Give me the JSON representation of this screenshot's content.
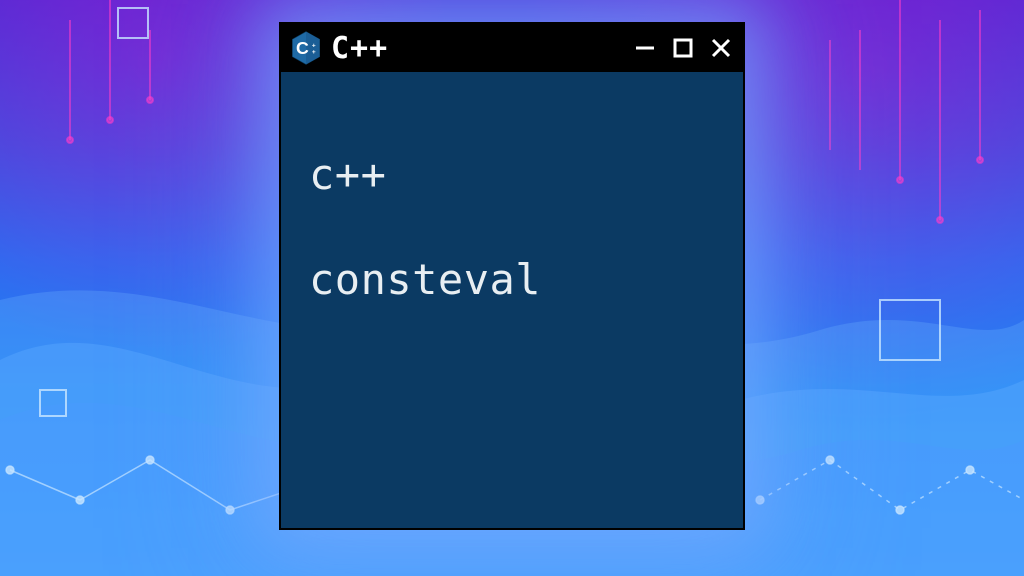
{
  "window": {
    "title": "C++",
    "icon": "cpp-icon"
  },
  "content": {
    "line1": "c++",
    "line2": "consteval"
  },
  "colors": {
    "window_bg": "#0b3a63",
    "titlebar_bg": "#000000",
    "text": "#e8eef2"
  }
}
